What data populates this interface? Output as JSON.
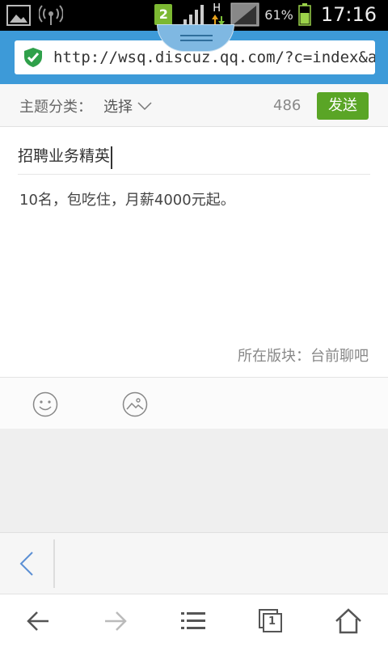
{
  "status_bar": {
    "notification_count": "2",
    "network_type": "H",
    "battery_percent": "61%",
    "time": "17:16",
    "icons": [
      "gallery-icon",
      "wifi-hotspot-icon",
      "signal-icon",
      "battery-icon"
    ]
  },
  "address_bar": {
    "url": "http://wsq.discuz.qq.com/?c=index&a=n",
    "secure_icon": "shield-check-icon"
  },
  "category_row": {
    "label": "主题分类：",
    "select_label": "选择",
    "char_count": "486",
    "send_label": "发送"
  },
  "post": {
    "title_value": "招聘业务精英",
    "content_value": "10名，包吃住，月薪4000元起。",
    "board_info": "所在版块：台前聊吧"
  },
  "toolbar": {
    "icons": [
      "emoji-icon",
      "image-icon"
    ]
  },
  "browser_nav": {
    "icons": [
      "back-arrow-icon",
      "forward-arrow-icon",
      "menu-icon",
      "tabs-icon",
      "home-icon"
    ],
    "tab_count": "1"
  },
  "colors": {
    "accent_blue": "#3d9ad8",
    "send_green": "#5aa526",
    "status_bar": "#000000"
  }
}
